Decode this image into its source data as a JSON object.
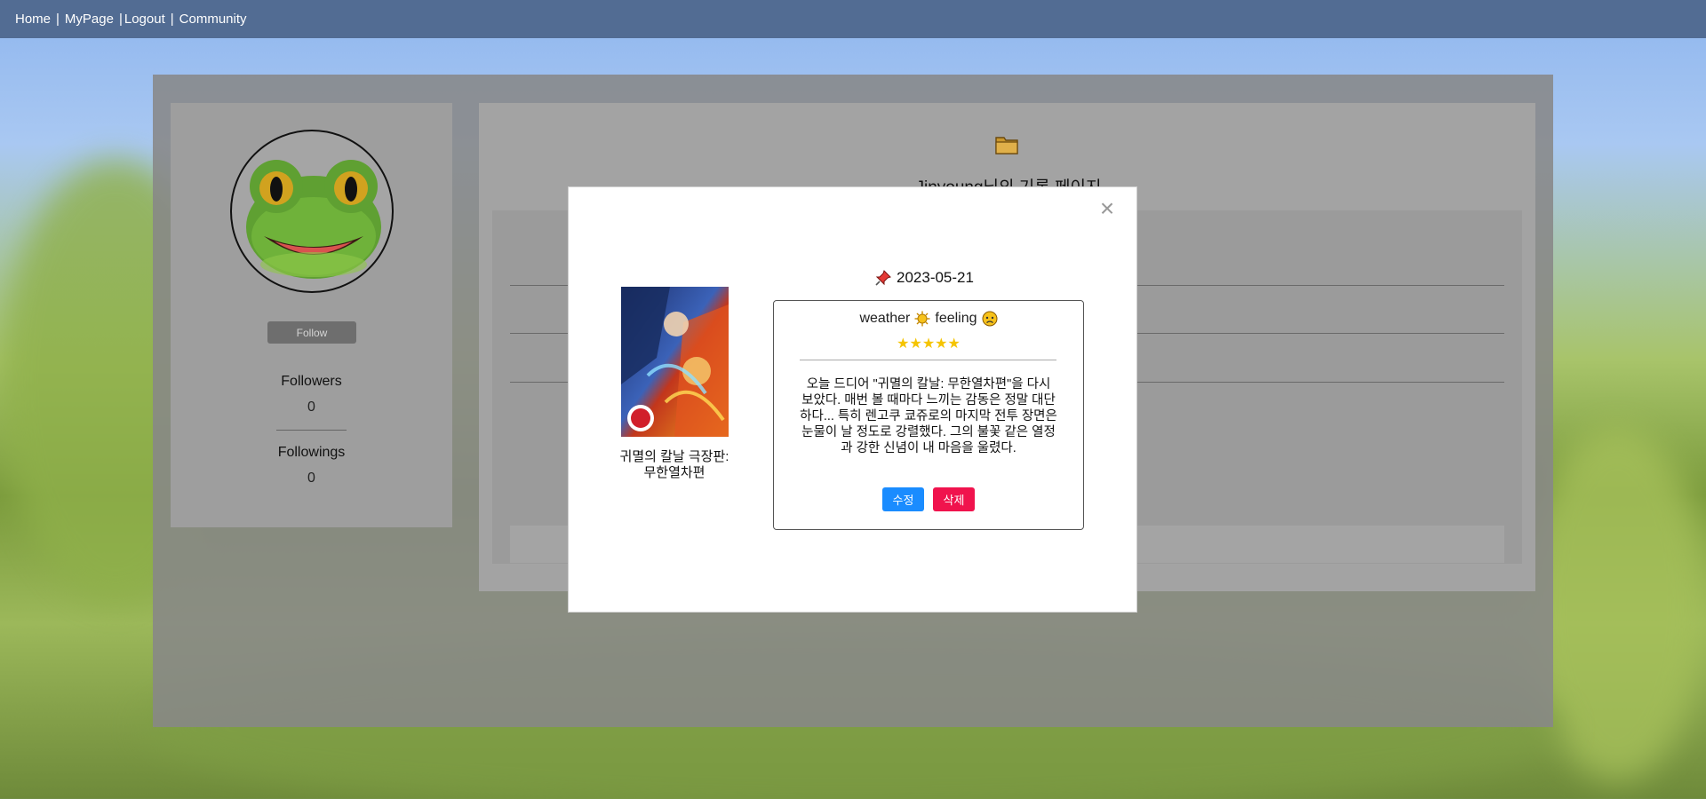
{
  "nav": {
    "items": [
      {
        "label": "Home",
        "sep": "|"
      },
      {
        "label": "MyPage",
        "sep": "|"
      },
      {
        "label": "Logout",
        "sep": "|"
      },
      {
        "label": "Community",
        "sep": ""
      }
    ]
  },
  "profile": {
    "avatar_icon": "frog-face-icon",
    "follow_label": "Follow",
    "followers_label": "Followers",
    "followers_count": "0",
    "followings_label": "Followings",
    "followings_count": "0"
  },
  "record_page": {
    "folder_icon": "folder-icon",
    "title": "Jinyoung님의 기록 페이지"
  },
  "modal": {
    "close_symbol": "×",
    "poster_icon": "movie-poster-image",
    "movie_title": "귀멸의 칼날 극장판: 무한열차편",
    "pin_icon": "pushpin-icon",
    "date": "2023-05-21",
    "weather_label": "weather",
    "weather_icon": "sun-icon",
    "feeling_label": "feeling",
    "feeling_icon": "sad-face-icon",
    "rating_stars": "★★★★★",
    "rating": 5,
    "review": "오늘 드디어 \"귀멸의 칼날: 무한열차편\"을 다시 보았다. 매번 볼 때마다 느끼는 감동은 정말 대단하다... 특히 렌고쿠 쿄쥬로의 마지막 전투 장면은 눈물이 날 정도로 강렬했다. 그의 불꽃 같은 열정과 강한 신념이 내 마음을 울렸다.",
    "edit_label": "수정",
    "delete_label": "삭제"
  },
  "colors": {
    "nav_bg": "#526c93",
    "edit_button": "#1a8cff",
    "delete_button": "#f0134d",
    "stars": "#f5c400"
  }
}
